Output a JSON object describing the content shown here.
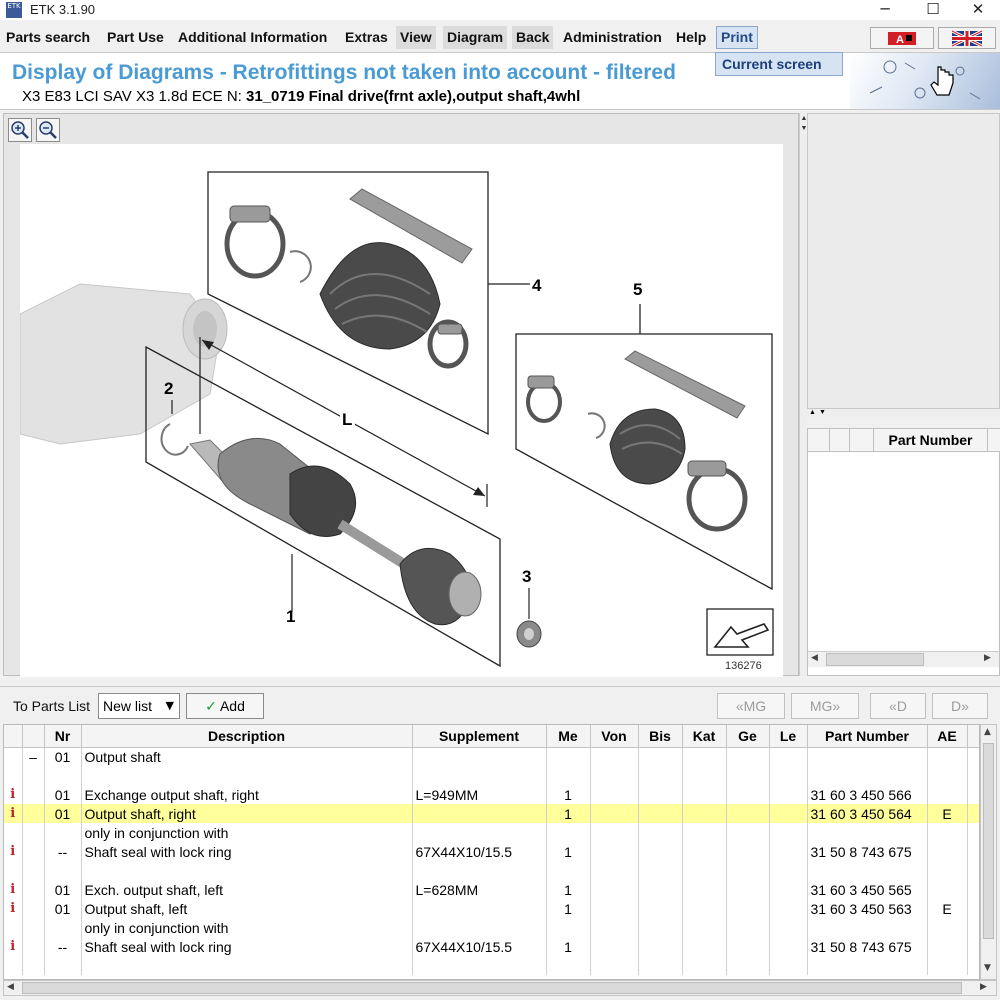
{
  "window": {
    "title": "ETK 3.1.90",
    "icon_text": "ETK",
    "minimize": "─",
    "maximize": "☐",
    "close": "✕"
  },
  "menu": {
    "items": [
      "Parts search",
      "Part Use",
      "Additional Information",
      "Extras",
      "View",
      "Diagram",
      "Back",
      "Administration",
      "Help",
      "Print"
    ],
    "dropdown": "Current screen"
  },
  "header": {
    "title": "Display of Diagrams - Retrofittings not taken into account - filtered",
    "vehicle": "X3 E83 LCI SAV X3 1.8d ECE",
    "n_label": "N:",
    "group": "31_0719 Final drive(frnt axle),output shaft,4whl"
  },
  "diagram": {
    "callouts": [
      "1",
      "2",
      "3",
      "4",
      "5"
    ],
    "dimension_label": "L",
    "image_number": "136276"
  },
  "right_panel": {
    "column_header": "Part Number"
  },
  "toolbar": {
    "to_parts_list": "To Parts List",
    "list_select": "New list",
    "add": "Add",
    "nav": [
      "«MG",
      "MG»",
      "«D",
      "D»"
    ]
  },
  "table": {
    "columns": [
      "",
      "",
      "Nr",
      "Description",
      "Supplement",
      "Me",
      "Von",
      "Bis",
      "Kat",
      "Ge",
      "Le",
      "Part Number",
      "AE"
    ],
    "rows": [
      {
        "info": "",
        "tree": "–",
        "nr": "01",
        "desc": "Output shaft",
        "supp": "",
        "me": "",
        "pn": "",
        "ae": "",
        "hl": false
      },
      {
        "info": "",
        "tree": "",
        "nr": "",
        "desc": "",
        "supp": "",
        "me": "",
        "pn": "",
        "ae": "",
        "hl": false
      },
      {
        "info": "i",
        "tree": "",
        "nr": "01",
        "desc": "Exchange output shaft, right",
        "supp": "L=949MM",
        "me": "1",
        "pn": "31 60 3 450 566",
        "ae": "",
        "hl": false
      },
      {
        "info": "i",
        "tree": "",
        "nr": "01",
        "desc": "Output shaft, right",
        "supp": "",
        "me": "1",
        "pn": "31 60 3 450 564",
        "ae": "E",
        "hl": true
      },
      {
        "info": "",
        "tree": "",
        "nr": "",
        "desc": "only in conjunction with",
        "supp": "",
        "me": "",
        "pn": "",
        "ae": "",
        "hl": false
      },
      {
        "info": "i",
        "tree": "",
        "nr": "--",
        "desc": "Shaft seal with lock ring",
        "supp": "67X44X10/15.5",
        "me": "1",
        "pn": "31 50 8 743 675",
        "ae": "",
        "hl": false
      },
      {
        "info": "",
        "tree": "",
        "nr": "",
        "desc": "",
        "supp": "",
        "me": "",
        "pn": "",
        "ae": "",
        "hl": false
      },
      {
        "info": "i",
        "tree": "",
        "nr": "01",
        "desc": "Exch. output shaft, left",
        "supp": "L=628MM",
        "me": "1",
        "pn": "31 60 3 450 565",
        "ae": "",
        "hl": false
      },
      {
        "info": "i",
        "tree": "",
        "nr": "01",
        "desc": "Output shaft, left",
        "supp": "",
        "me": "1",
        "pn": "31 60 3 450 563",
        "ae": "E",
        "hl": false
      },
      {
        "info": "",
        "tree": "",
        "nr": "",
        "desc": "only in conjunction with",
        "supp": "",
        "me": "",
        "pn": "",
        "ae": "",
        "hl": false
      },
      {
        "info": "i",
        "tree": "",
        "nr": "--",
        "desc": "Shaft seal with lock ring",
        "supp": "67X44X10/15.5",
        "me": "1",
        "pn": "31 50 8 743 675",
        "ae": "",
        "hl": false
      },
      {
        "info": "",
        "tree": "",
        "nr": "",
        "desc": "",
        "supp": "",
        "me": "",
        "pn": "",
        "ae": "",
        "hl": false
      }
    ]
  },
  "colors": {
    "title_blue": "#4a9ad4",
    "highlight_row": "#ffff9c",
    "info_red": "#c0202a",
    "add_check": "#1f9b34"
  }
}
